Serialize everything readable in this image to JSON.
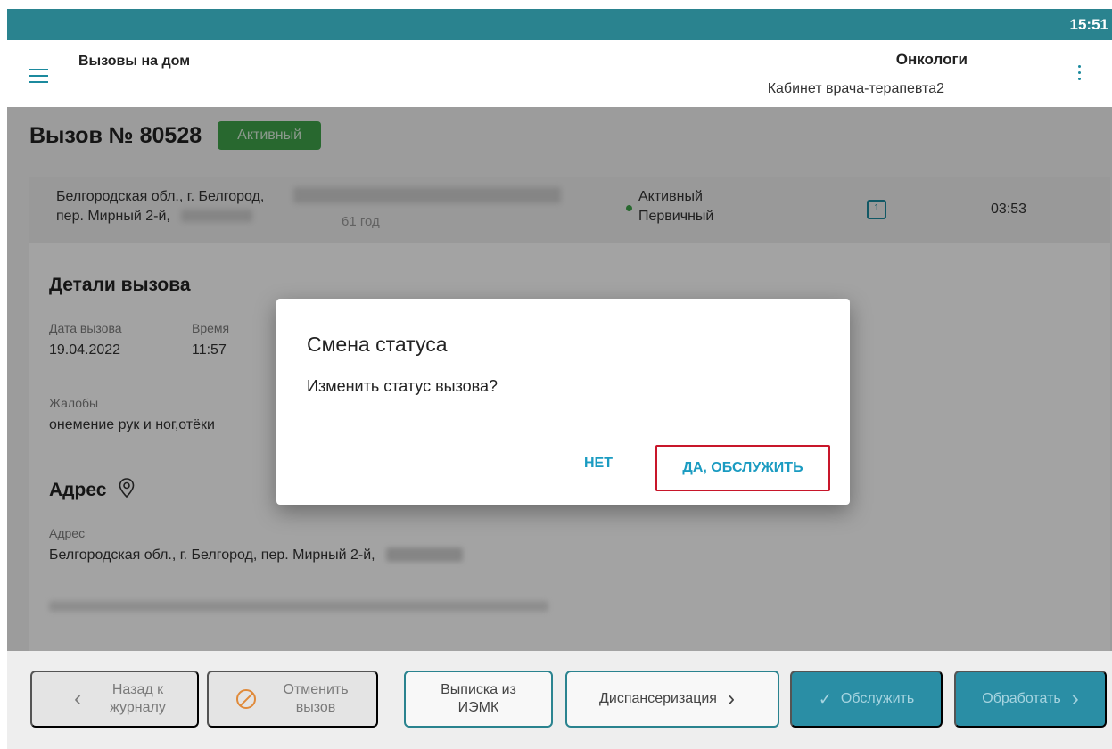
{
  "statusbar": {
    "clock": "15:51"
  },
  "appbar": {
    "title": "Вызовы на дом",
    "department": "Онкологи",
    "room": "Кабинет врача-терапевта2"
  },
  "call": {
    "title": "Вызов № 80528",
    "badge": "Активный",
    "badge_color": "#3fa34a",
    "address_line1": "Белгородская обл., г. Белгород,",
    "address_line2": "пер. Мирный 2-й,",
    "age": "61 год",
    "status_line1": "Активный",
    "status_line2": "Первичный",
    "call_icon": "1",
    "time": "03:53"
  },
  "details": {
    "section_title": "Детали вызова",
    "date_label": "Дата вызова",
    "date_value": "19.04.2022",
    "time_label": "Время",
    "time_value": "11:57",
    "complaints_label": "Жалобы",
    "complaints_value": "онемение рук и ног,отёки"
  },
  "address": {
    "section_title": "Адрес",
    "label": "Адрес",
    "value": "Белгородская обл., г. Белгород, пер. Мирный 2-й,"
  },
  "dialog": {
    "title": "Смена статуса",
    "message": "Изменить статус вызова?",
    "no_label": "НЕТ",
    "yes_label": "ДА, ОБСЛУЖИТЬ",
    "highlight_color": "#c8162a"
  },
  "bottombar": {
    "back_label": "Назад к\nжурналу",
    "cancel_label": "Отменить\nвызов",
    "iemk_label": "Выписка из\nИЭМК",
    "disp_label": "Диспансеризация",
    "serve_label": "Обслужить",
    "process_label": "Обработать"
  },
  "colors": {
    "accent": "#2a838f",
    "button_blue": "#2a8ea5"
  }
}
